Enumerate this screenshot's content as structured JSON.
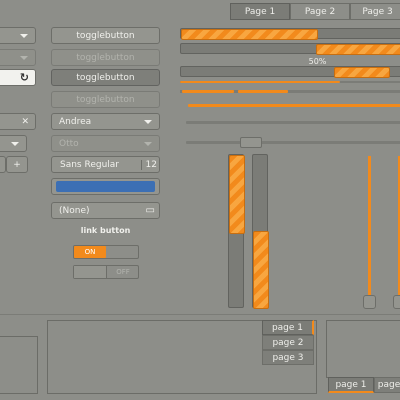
{
  "notebook_tabs": [
    "Page 1",
    "Page 2",
    "Page 3"
  ],
  "left_column": {
    "close_glyph": "✕",
    "add_glyph": "+"
  },
  "toggle_buttons": [
    "togglebutton",
    "togglebutton",
    "togglebutton",
    "togglebutton"
  ],
  "combo_andrea": "Andrea",
  "combo_otto": "Otto",
  "font_button": {
    "family": "Sans Regular",
    "size": "12"
  },
  "color_button": {
    "color": "#3c6fb4"
  },
  "file_chooser": {
    "label": "(None)"
  },
  "link_button": "link button",
  "switch_on": "ON",
  "switch_off": "OFF",
  "progress": {
    "bar1": 0.6,
    "bar2": 0.6,
    "bar3_label": "50%",
    "bar3": 0.5
  },
  "vertical_bars": {
    "left_fill": 0.5,
    "right_fill": 0.5
  },
  "side_tabs": [
    "page 1",
    "page 2",
    "page 3"
  ],
  "bottom_tabs": [
    "page 1",
    "page"
  ],
  "colors": {
    "accent": "#f28a1c",
    "bg": "#8d8e89"
  }
}
